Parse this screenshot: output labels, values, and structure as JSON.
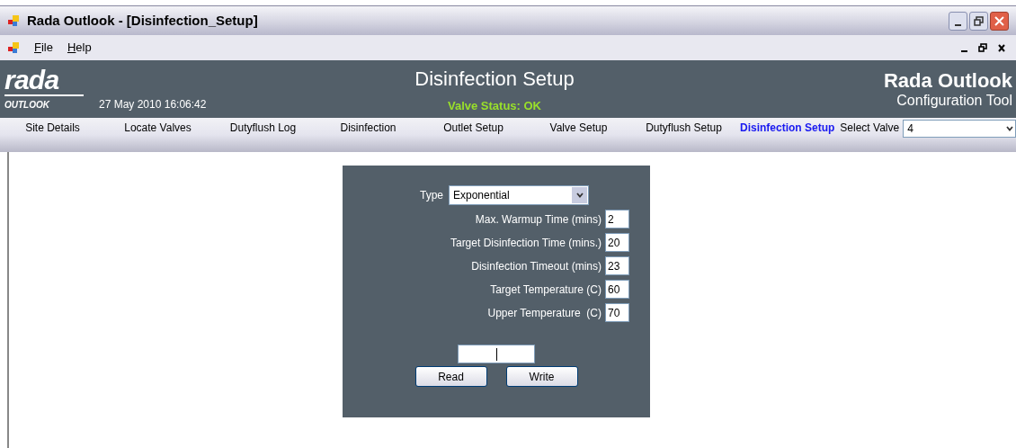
{
  "window": {
    "title": "Rada Outlook - [Disinfection_Setup]"
  },
  "menu": [
    {
      "label": "File"
    },
    {
      "label": "Help"
    }
  ],
  "header": {
    "logo_top": "rada",
    "logo_bottom": "OUTLOOK",
    "datetime": "27 May 2010 16:06:42",
    "title": "Disinfection Setup",
    "valve_status": "Valve Status: OK",
    "app_name": "Rada Outlook",
    "app_subtitle": "Configuration Tool"
  },
  "nav": [
    {
      "label": "Site Details",
      "selected": false
    },
    {
      "label": "Locate Valves",
      "selected": false
    },
    {
      "label": "Dutyflush Log",
      "selected": false
    },
    {
      "label": "Disinfection",
      "selected": false
    },
    {
      "label": "Outlet Setup",
      "selected": false
    },
    {
      "label": "Valve Setup",
      "selected": false
    },
    {
      "label": "Dutyflush Setup",
      "selected": false
    },
    {
      "label": "Disinfection Setup",
      "selected": true
    }
  ],
  "select_valve": {
    "label": "Select Valve",
    "value": "4"
  },
  "form": {
    "type_label": "Type",
    "type_value": "Exponential",
    "fields": [
      {
        "label": "Max. Warmup Time (mins)",
        "value": "2"
      },
      {
        "label": "Target Disinfection Time (mins.)",
        "value": "20"
      },
      {
        "label": "Disinfection Timeout (mins)",
        "value": "23"
      },
      {
        "label": "Target Temperature (C)",
        "value": "60"
      },
      {
        "label": "Upper Temperature  (C)",
        "value": "70"
      }
    ],
    "buttons": [
      "Read",
      "Write"
    ]
  }
}
